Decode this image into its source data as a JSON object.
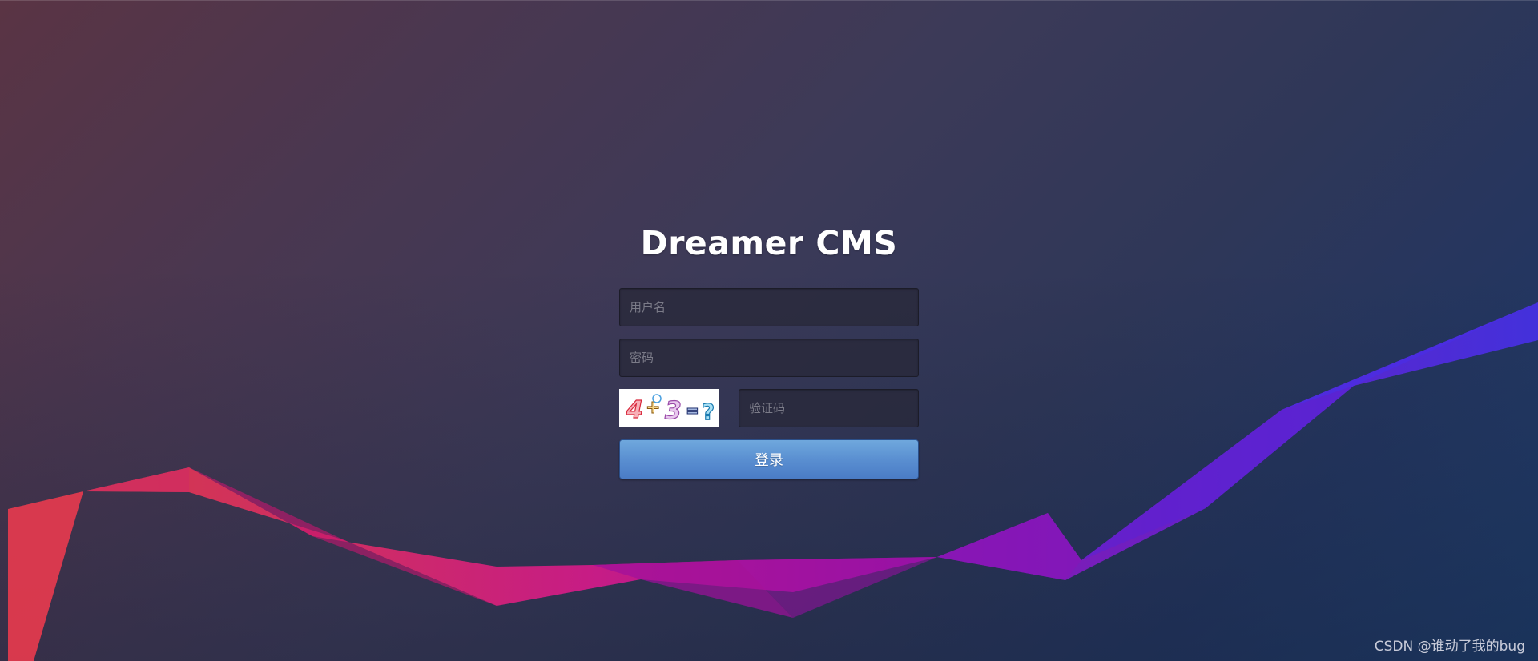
{
  "login": {
    "title": "Dreamer CMS",
    "username_placeholder": "用户名",
    "password_placeholder": "密码",
    "captcha_placeholder": "验证码",
    "captcha_text": "4+3=?",
    "submit_label": "登录"
  },
  "watermark": "CSDN @谁动了我的bug",
  "colors": {
    "accent_button": "#5a8fd1",
    "wave_start": "#e03a4e",
    "wave_mid": "#b0179e",
    "wave_end": "#4a2ee0"
  }
}
